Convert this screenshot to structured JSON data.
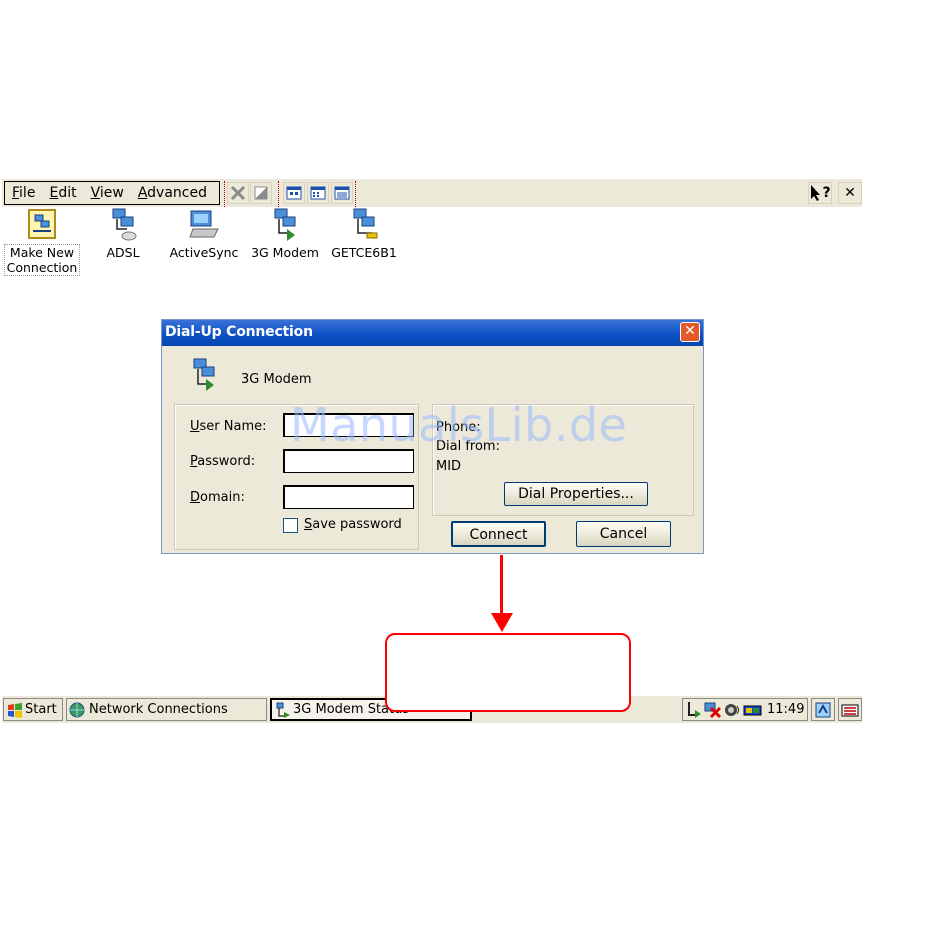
{
  "menu": {
    "items": [
      {
        "label": "File"
      },
      {
        "label": "Edit"
      },
      {
        "label": "View"
      },
      {
        "label": "Advanced"
      }
    ]
  },
  "toolbar": {
    "help_glyph": "?",
    "close_glyph": "✕"
  },
  "desktop_icons": [
    {
      "label": "Make New Connection",
      "icon": "make-new-connection-icon"
    },
    {
      "label": "ADSL",
      "icon": "network-connection-icon"
    },
    {
      "label": "ActiveSync",
      "icon": "activesync-icon"
    },
    {
      "label": "3G Modem",
      "icon": "modem-connection-icon"
    },
    {
      "label": "GETCE6B1",
      "icon": "lan-connection-icon"
    }
  ],
  "dialog": {
    "title": "Dial-Up Connection",
    "close_glyph": "✕",
    "connection_name": "3G Modem",
    "user_name_label": "User Name:",
    "password_label": "Password:",
    "domain_label": "Domain:",
    "user_name_value": "",
    "password_value": "",
    "domain_value": "",
    "save_password_label": "Save password",
    "save_password_checked": false,
    "phone_label": "Phone:",
    "dial_from_label": "Dial from:",
    "dial_from_value": "MID",
    "dial_properties_label": "Dial Properties...",
    "connect_label": "Connect",
    "cancel_label": "Cancel"
  },
  "taskbar": {
    "start_label": "Start",
    "tasks": [
      {
        "label": "Network Connections"
      },
      {
        "label": "3G Modem Status"
      }
    ],
    "clock": "11:49"
  },
  "watermark": "ManualsLib.de",
  "colors": {
    "titlebar": "#0a4fc4",
    "surface": "#ece9d8",
    "annotation": "#ff0000"
  }
}
